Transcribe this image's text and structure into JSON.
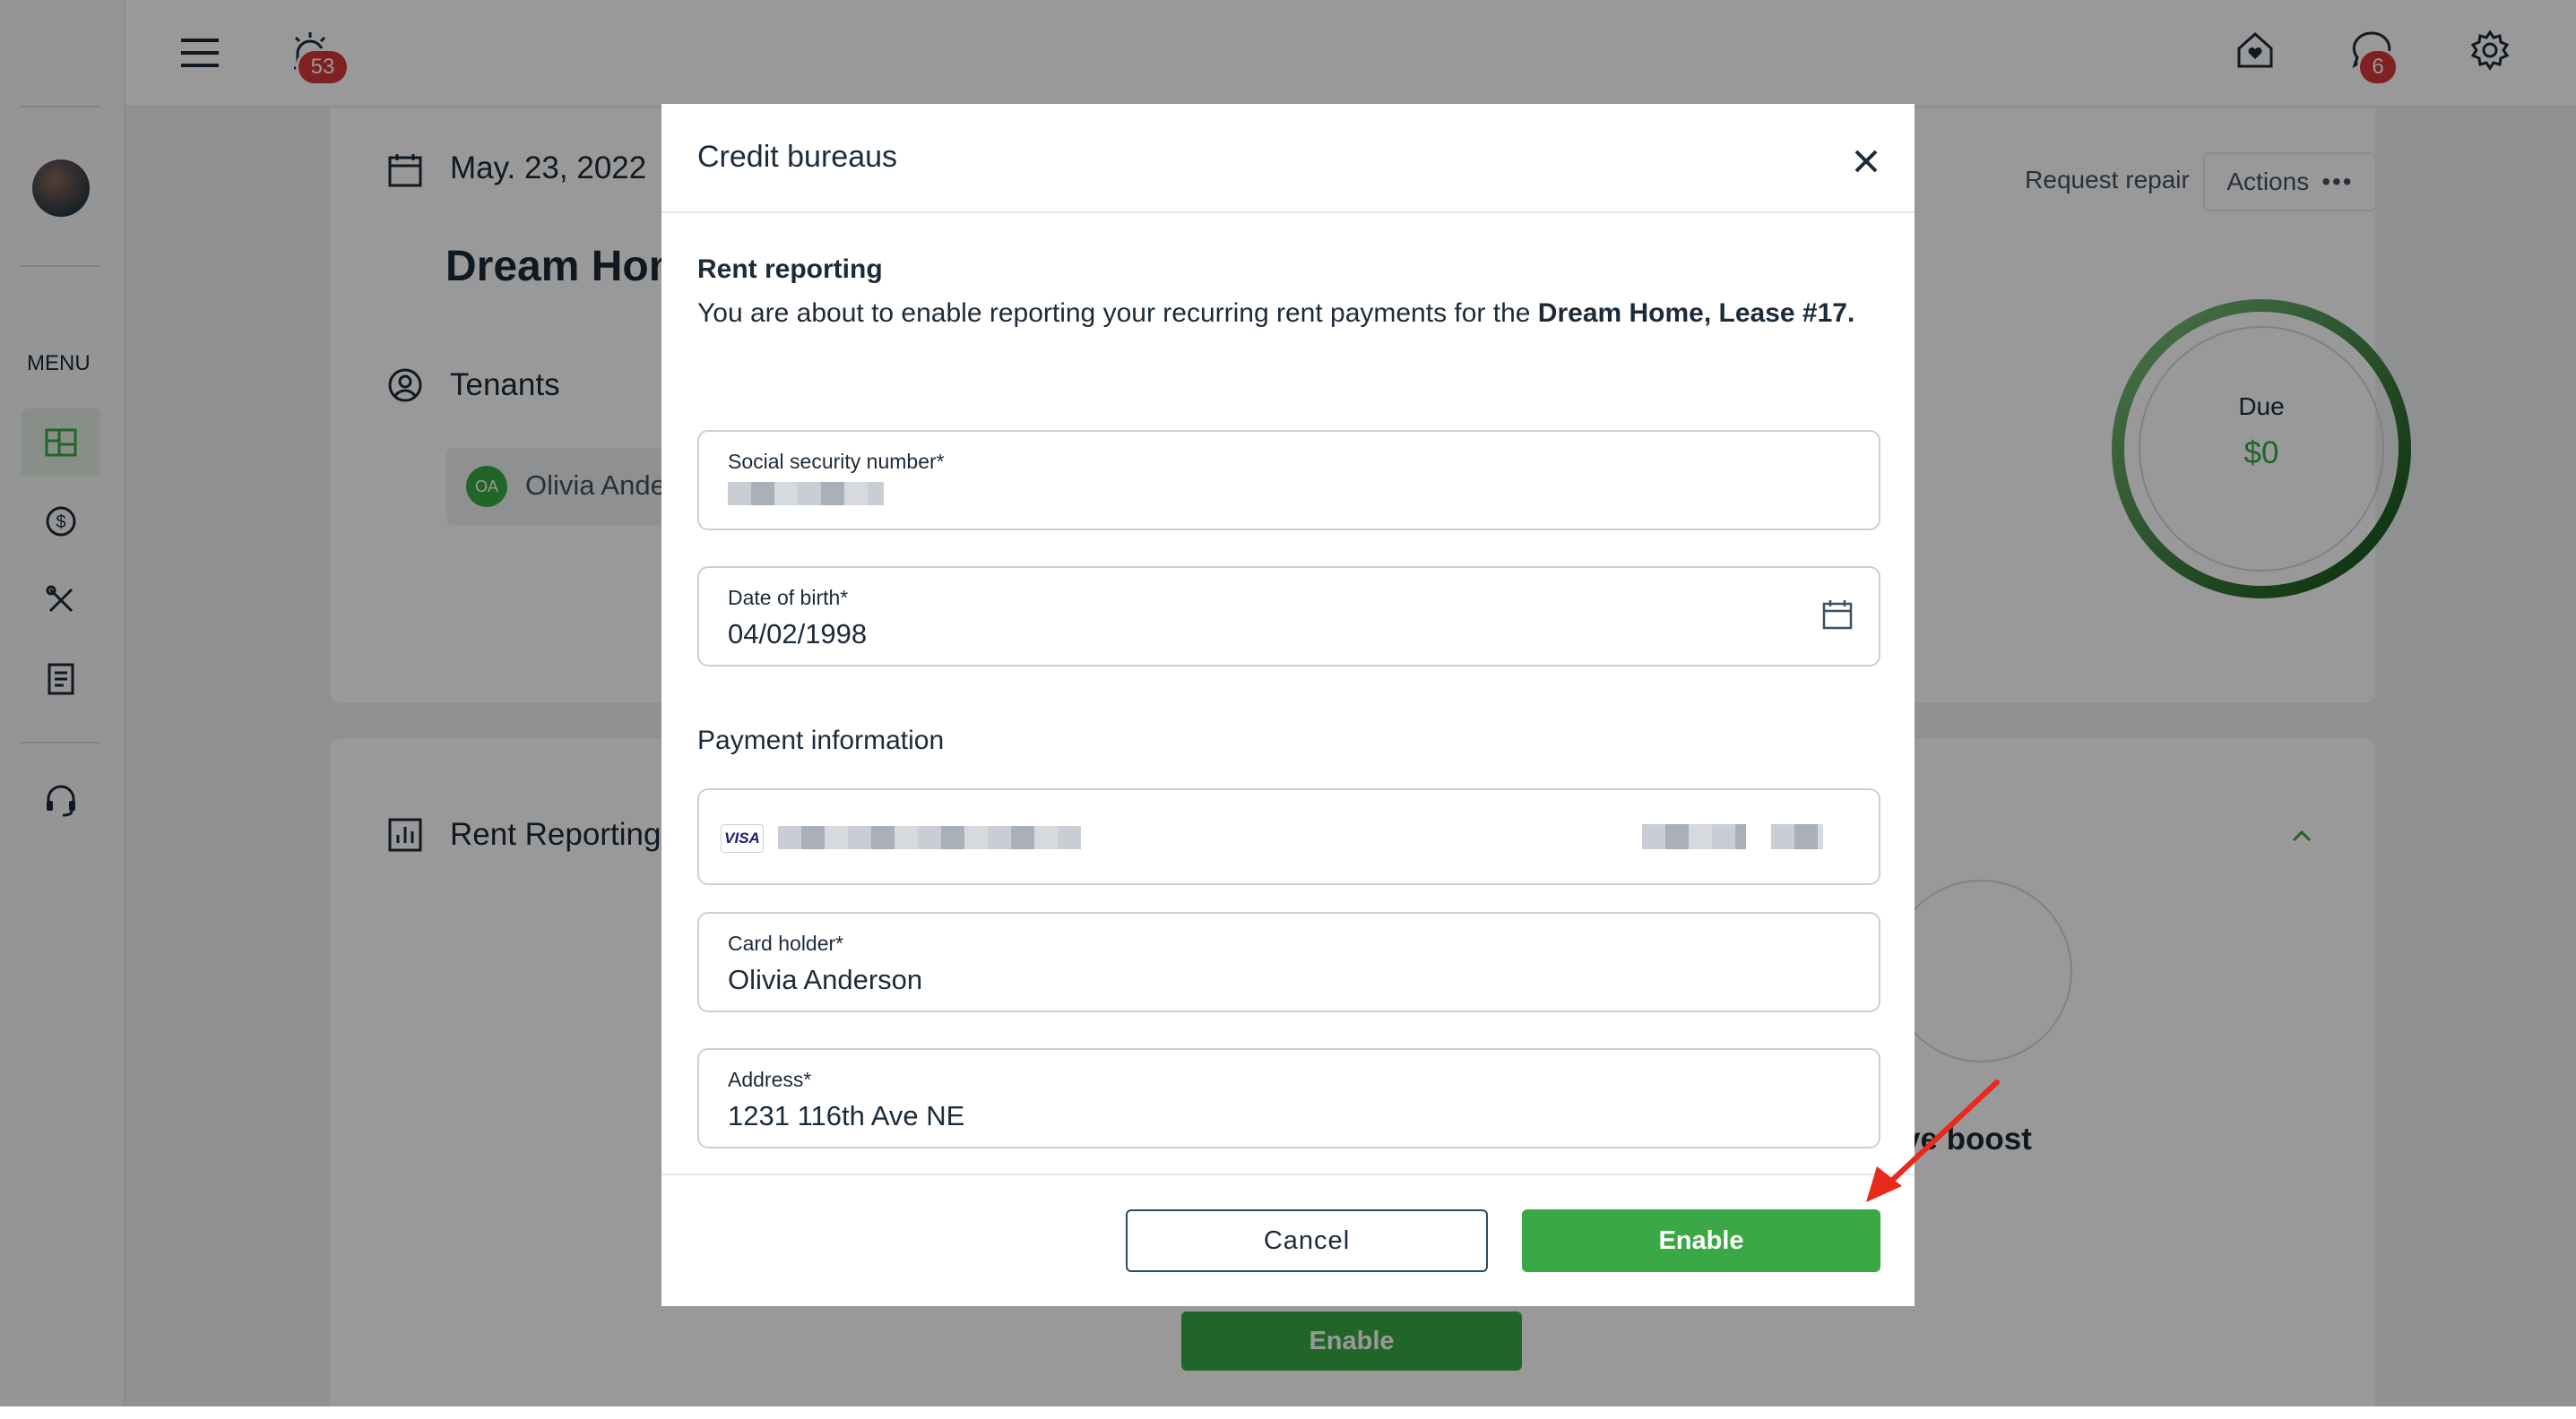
{
  "topbar": {
    "notifications_count": "53",
    "messages_count": "6"
  },
  "sidebar": {
    "menu_label": "MENU"
  },
  "lease": {
    "date": "May. 23, 2022",
    "property_title": "Dream Hom",
    "tenants_label": "Tenants",
    "tenant_initials": "OA",
    "tenant_name": "Olivia Ande",
    "request_repair_label": "Request repair",
    "actions_label": "Actions",
    "due_label": "Due",
    "due_amount": "$0"
  },
  "rent_reporting_section": {
    "title": "Rent Reporting",
    "boost_text": "ve boost",
    "enable_label": "Enable"
  },
  "modal": {
    "title": "Credit bureaus",
    "section_title": "Rent reporting",
    "description_prefix": "You are about to enable reporting your recurring rent payments for the ",
    "description_bold": "Dream Home, Lease #17.",
    "ssn": {
      "label": "Social security number*",
      "value": ""
    },
    "dob": {
      "label": "Date of birth*",
      "value": "04/02/1998"
    },
    "payment_info_label": "Payment information",
    "card_brand": "VISA",
    "card_holder": {
      "label": "Card holder*",
      "value": "Olivia Anderson"
    },
    "address": {
      "label": "Address*",
      "value": "1231 116th Ave NE"
    },
    "cancel_label": "Cancel",
    "enable_label": "Enable"
  },
  "colors": {
    "brand_green": "#3aa844",
    "dark_navy": "#1b2b3a",
    "badge_red": "#d63838"
  }
}
